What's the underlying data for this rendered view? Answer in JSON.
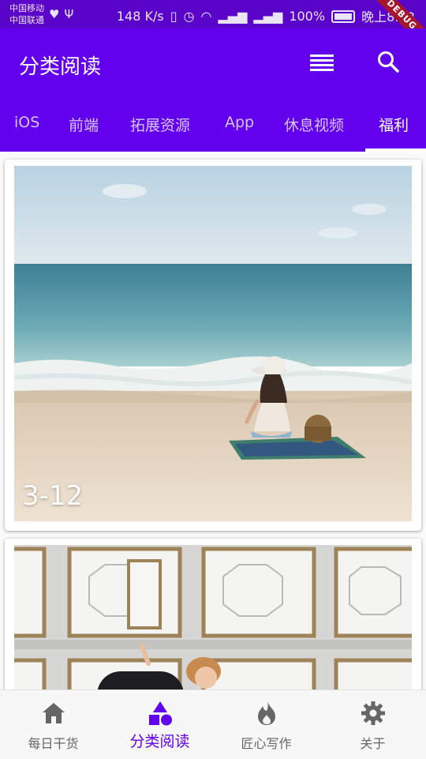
{
  "status_bar": {
    "carrier_1": "中国移动",
    "carrier_2": "中国联通",
    "speed": "148 K/s",
    "battery": "100%",
    "time": "晚上8:52",
    "debug": "DEBUG"
  },
  "app_bar": {
    "title": "分类阅读",
    "color": "#6200ee",
    "tabs": [
      {
        "label": "iOS"
      },
      {
        "label": "前端"
      },
      {
        "label": "拓展资源"
      },
      {
        "label": "App"
      },
      {
        "label": "休息视频"
      },
      {
        "label": "福利",
        "active": true
      }
    ]
  },
  "feed": {
    "cards": [
      {
        "date": "3-12",
        "image": "woman-on-beach-photo"
      },
      {
        "date": "",
        "image": "woman-by-windows-photo"
      }
    ]
  },
  "bottom_nav": {
    "items": [
      {
        "label": "每日干货",
        "icon": "home-icon"
      },
      {
        "label": "分类阅读",
        "icon": "shapes-icon",
        "active": true
      },
      {
        "label": "匠心写作",
        "icon": "flame-icon"
      },
      {
        "label": "关于",
        "icon": "gear-icon"
      }
    ]
  }
}
